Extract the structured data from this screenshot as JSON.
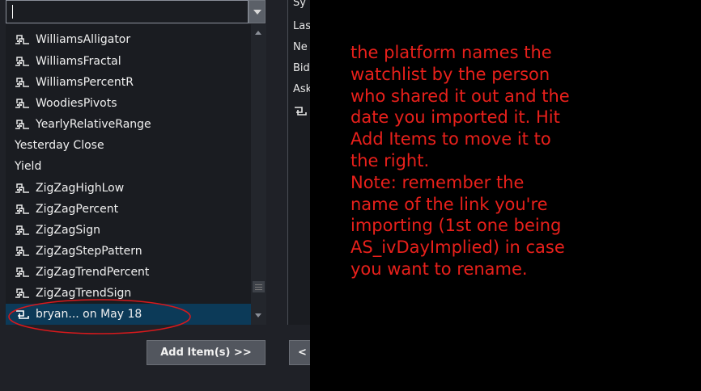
{
  "search": {
    "value": "",
    "placeholder": ""
  },
  "list": {
    "items": [
      {
        "label": "WilliamsAlligator",
        "icon": "study-link-icon"
      },
      {
        "label": "WilliamsFractal",
        "icon": "study-link-icon"
      },
      {
        "label": "WilliamsPercentR",
        "icon": "study-link-icon"
      },
      {
        "label": "WoodiesPivots",
        "icon": "study-link-icon"
      },
      {
        "label": "YearlyRelativeRange",
        "icon": "study-link-icon"
      },
      {
        "label": "Yesterday Close",
        "icon": ""
      },
      {
        "label": "Yield",
        "icon": ""
      },
      {
        "label": "ZigZagHighLow",
        "icon": "study-link-icon"
      },
      {
        "label": "ZigZagPercent",
        "icon": "study-link-icon"
      },
      {
        "label": "ZigZagSign",
        "icon": "study-link-icon"
      },
      {
        "label": "ZigZagStepPattern",
        "icon": "study-link-icon"
      },
      {
        "label": "ZigZagTrendPercent",
        "icon": "study-link-icon"
      },
      {
        "label": "ZigZagTrendSign",
        "icon": "study-link-icon"
      },
      {
        "label": "bryan... on May 18",
        "icon": "shared-link-icon",
        "selected": true
      }
    ]
  },
  "buttons": {
    "add_items": "Add Item(s) >>",
    "remove": "<"
  },
  "right_columns": [
    "Sy",
    "Las",
    "Ne",
    "Bid",
    "Ask"
  ],
  "annotation": {
    "text": "the platform names the\nwatchlist by the person\nwho shared it out and the\ndate you imported it.  Hit\nAdd Items to move it to\nthe right.\nNote:  remember the\nname of the link you're\nimporting (1st one being\nAS_ivDayImplied) in case\nyou want to rename."
  },
  "colors": {
    "annotation_text": "#e8201b",
    "selection": "#0c3a58",
    "panel_bg": "#1f2127",
    "highlight_ellipse": "#d7191c"
  }
}
